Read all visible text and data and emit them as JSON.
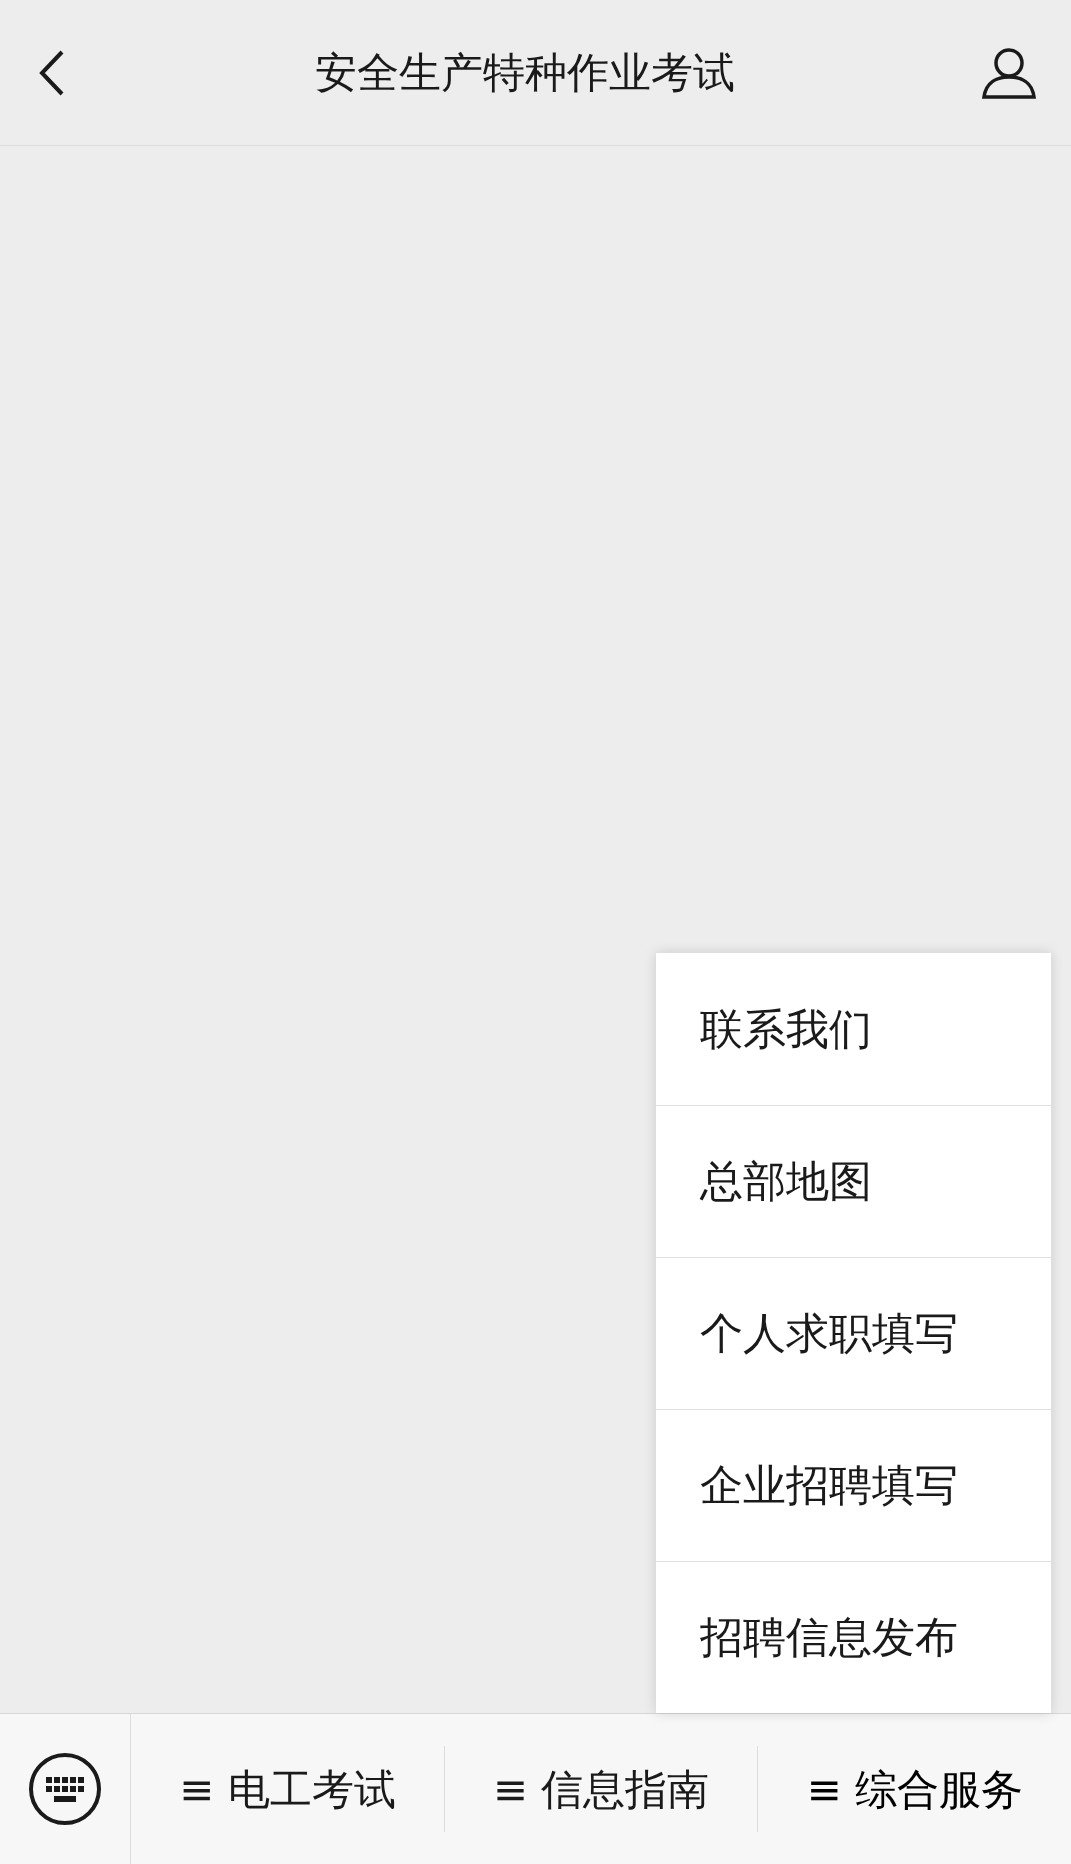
{
  "header": {
    "title": "安全生产特种作业考试"
  },
  "bottom_menus": [
    {
      "label": "≡ 电工考试",
      "expanded": false
    },
    {
      "label": "≡ 信息指南",
      "expanded": false
    },
    {
      "label": "≡ 综合服务",
      "expanded": true,
      "items": [
        {
          "label": "联系我们"
        },
        {
          "label": "总部地图"
        },
        {
          "label": "个人求职填写"
        },
        {
          "label": "企业招聘填写"
        },
        {
          "label": "招聘信息发布"
        }
      ]
    }
  ]
}
